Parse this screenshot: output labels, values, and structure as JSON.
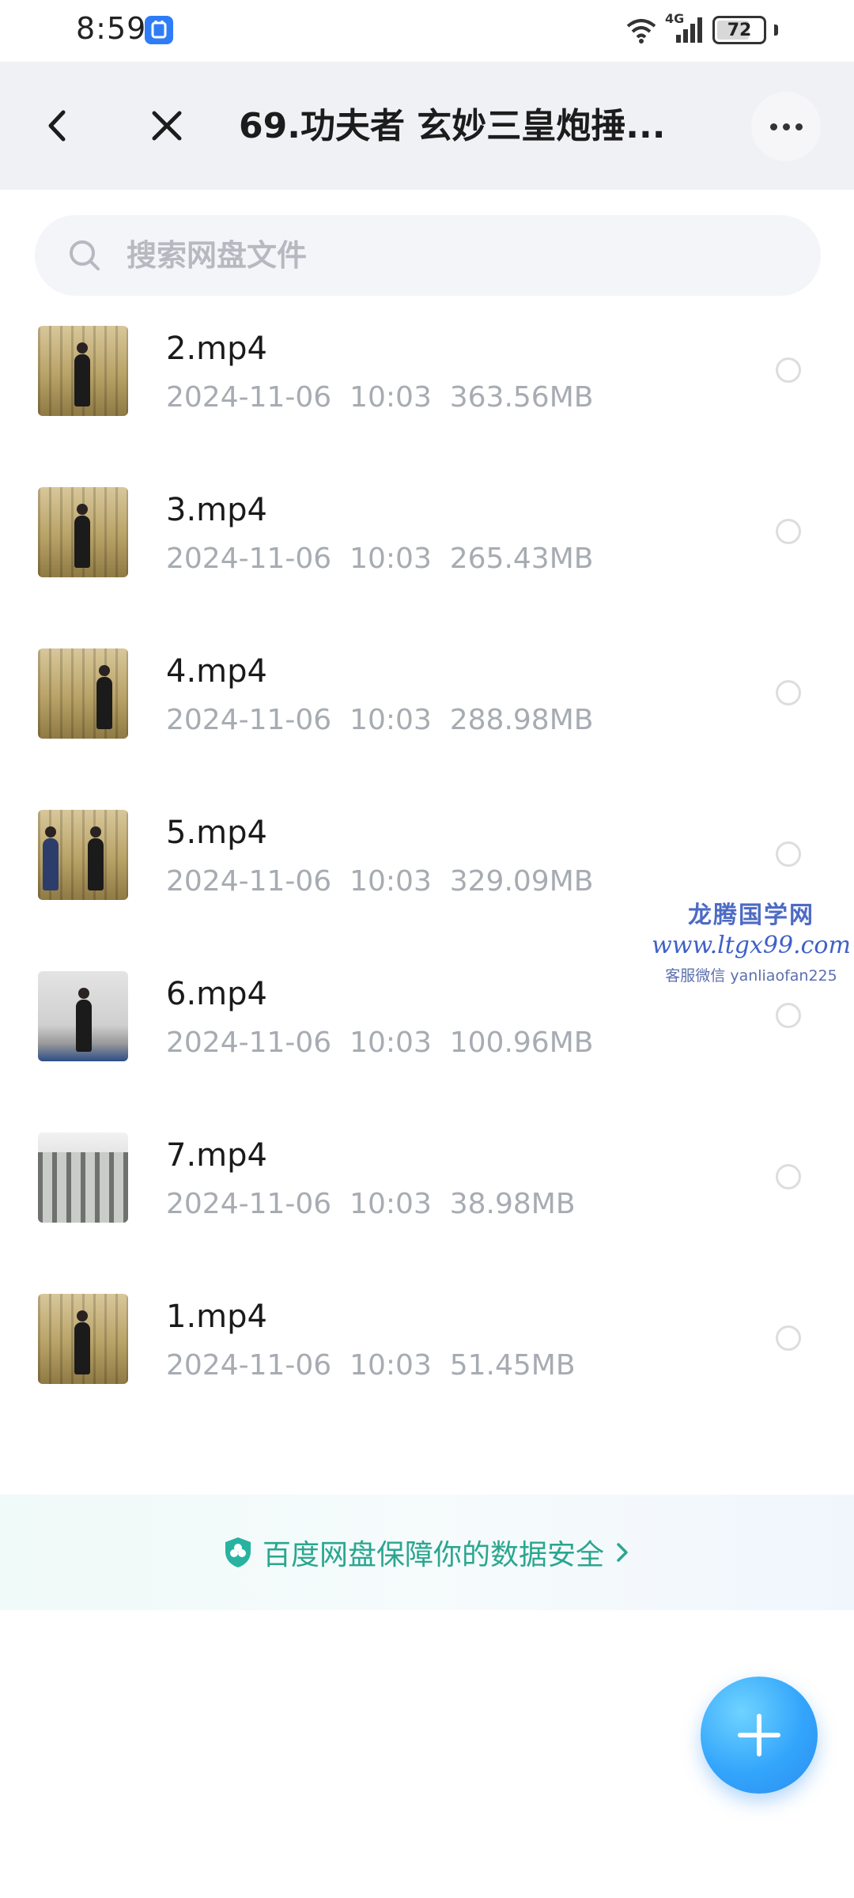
{
  "status_bar": {
    "time": "8:59",
    "network": "4G",
    "battery": "72",
    "battery_level": 0.72
  },
  "nav": {
    "title": "69.功夫者 玄妙三皇炮捶..."
  },
  "search": {
    "placeholder": "搜索网盘文件"
  },
  "files": [
    {
      "name": "2.mp4",
      "date": "2024-11-06",
      "time": "10:03",
      "size": "363.56MB",
      "thumb": "curtain"
    },
    {
      "name": "3.mp4",
      "date": "2024-11-06",
      "time": "10:03",
      "size": "265.43MB",
      "thumb": "curtain"
    },
    {
      "name": "4.mp4",
      "date": "2024-11-06",
      "time": "10:03",
      "size": "288.98MB",
      "thumb": "curtain"
    },
    {
      "name": "5.mp4",
      "date": "2024-11-06",
      "time": "10:03",
      "size": "329.09MB",
      "thumb": "curtain"
    },
    {
      "name": "6.mp4",
      "date": "2024-11-06",
      "time": "10:03",
      "size": "100.96MB",
      "thumb": "gray"
    },
    {
      "name": "7.mp4",
      "date": "2024-11-06",
      "time": "10:03",
      "size": "38.98MB",
      "thumb": "hall"
    },
    {
      "name": "1.mp4",
      "date": "2024-11-06",
      "time": "10:03",
      "size": "51.45MB",
      "thumb": "curtain"
    }
  ],
  "security_banner": {
    "text": "百度网盘保障你的数据安全"
  },
  "watermark": {
    "title": "龙腾国学网",
    "url": "www.ltgx99.com",
    "contact": "客服微信 yanliaofan225"
  },
  "colors": {
    "accent": "#2f8ff5",
    "security_green": "#2aa68f"
  },
  "icons": {
    "back": "chevron-left-icon",
    "close": "close-icon",
    "more": "more-horizontal-icon",
    "search": "search-icon",
    "shield": "shield-icon",
    "add": "plus-icon"
  }
}
